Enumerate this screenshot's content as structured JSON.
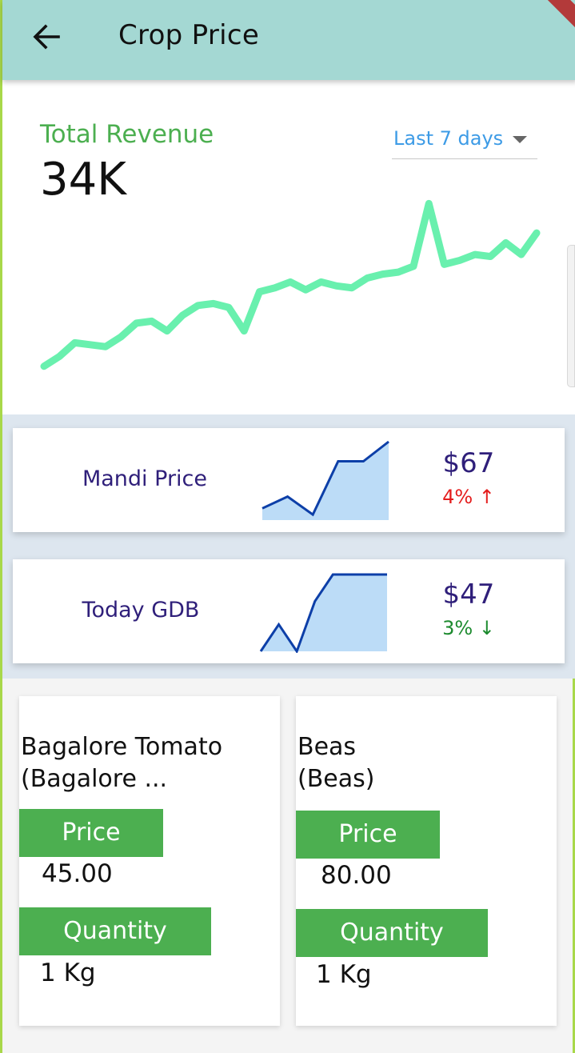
{
  "app": {
    "title": "Crop Price"
  },
  "revenue": {
    "label": "Total Revenue",
    "value": "34K",
    "period": "Last 7 days",
    "colors": {
      "line": "#69f0ae",
      "label": "#4caf50",
      "period": "#3d9be6"
    }
  },
  "chart_data": [
    {
      "type": "line",
      "x": [
        0,
        1,
        2,
        3,
        4,
        5,
        6,
        7,
        8,
        9,
        10,
        11,
        12,
        13,
        14,
        15,
        16,
        17,
        18,
        19,
        20,
        21,
        22,
        23,
        24,
        25,
        26,
        27,
        28,
        29,
        30,
        31,
        32
      ],
      "values": [
        5,
        10,
        17,
        16,
        15,
        20,
        27,
        28,
        23,
        31,
        36,
        37,
        35,
        23,
        43,
        45,
        48,
        44,
        48,
        46,
        45,
        50,
        52,
        53,
        56,
        88,
        57,
        59,
        62,
        61,
        68,
        62,
        73
      ],
      "ylim": [
        0,
        100
      ],
      "grid": false,
      "color": "#69f0ae"
    },
    {
      "type": "area",
      "x": [
        0,
        1,
        2,
        3,
        4,
        5,
        6,
        7
      ],
      "values": [
        15,
        30,
        7,
        75,
        75,
        100
      ],
      "ylim": [
        0,
        100
      ],
      "color": "#0d3fa8",
      "fill": "#bcdcf7"
    },
    {
      "type": "area",
      "x": [
        0,
        1,
        2,
        3,
        4,
        5,
        6,
        7
      ],
      "values": [
        0,
        35,
        0,
        65,
        100,
        100,
        100,
        100
      ],
      "ylim": [
        0,
        100
      ],
      "color": "#0d3fa8",
      "fill": "#bcdcf7"
    }
  ],
  "stats": [
    {
      "name": "Mandi Price",
      "amount": "$67",
      "change": "4% ↑",
      "change_color": "#e41e1e"
    },
    {
      "name": "Today GDB",
      "amount": "$47",
      "change": "3% ↓",
      "change_color": "#1c8a2e"
    }
  ],
  "products": [
    {
      "name_line1": "Bagalore Tomato",
      "name_line2": "(Bagalore ...",
      "price_label": "Price",
      "price": "45.00",
      "quantity_label": "Quantity",
      "quantity": "1 Kg"
    },
    {
      "name_line1": "Beas",
      "name_line2": "(Beas)",
      "price_label": "Price",
      "price": "80.00",
      "quantity_label": "Quantity",
      "quantity": "1 Kg"
    }
  ],
  "icons": {
    "back": "arrow-left-icon",
    "dropdown": "triangle-down-icon"
  }
}
